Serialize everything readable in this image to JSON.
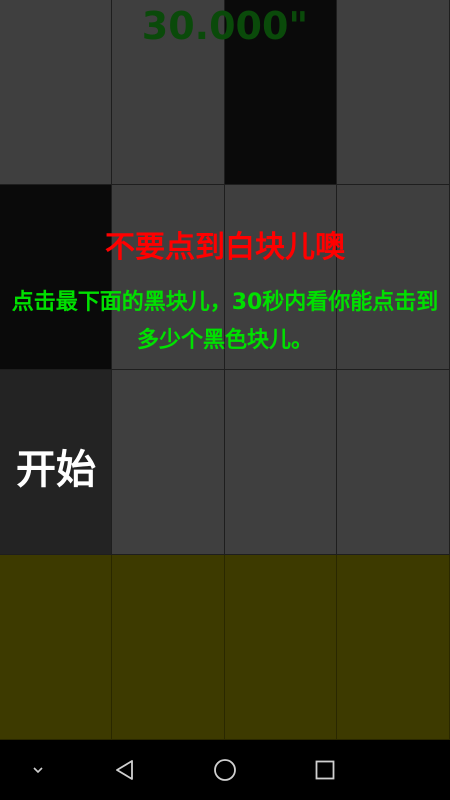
{
  "game": {
    "timer": "30.000\"",
    "warning": "不要点到白块儿噢",
    "instruction": "点击最下面的黑块儿，30秒内看你能点击到多少个黑色块儿。",
    "start_label": "开始"
  },
  "board": {
    "rows": [
      [
        "white",
        "white",
        "black",
        "white"
      ],
      [
        "black",
        "white",
        "white",
        "white"
      ],
      [
        "start",
        "white",
        "white",
        "white"
      ],
      [
        "done",
        "done",
        "done",
        "done"
      ]
    ]
  },
  "colors": {
    "timer": "#0a4a0a",
    "warning": "#ff0000",
    "instruction": "#00e000",
    "tile_white": "#3f3f3f",
    "tile_black": "#0a0a0a",
    "tile_done": "#3d3a00"
  },
  "navbar": {
    "buttons": [
      "chevron-down-icon",
      "back-triangle-icon",
      "home-circle-icon",
      "recents-square-icon"
    ]
  }
}
